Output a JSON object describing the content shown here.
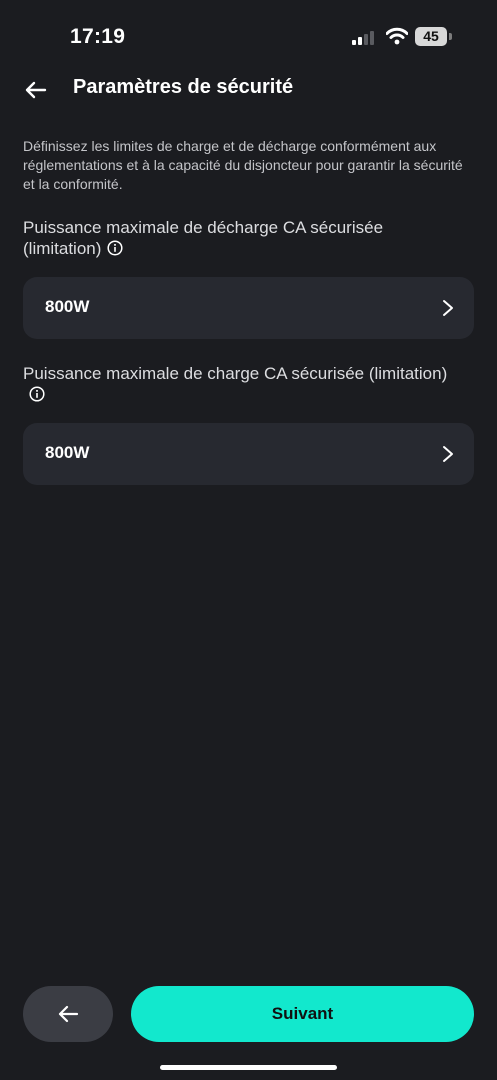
{
  "status_bar": {
    "time": "17:19",
    "battery": "45"
  },
  "header": {
    "title": "Paramètres de sécurité",
    "back_icon": "arrow-left-icon"
  },
  "description": "Définissez les limites de charge et de décharge conformément aux réglementations et à la capacité du disjoncteur pour garantir la sécurité et la conformité.",
  "settings": [
    {
      "label": "Puissance maximale de décharge CA sécurisée (limitation)",
      "value": "800W"
    },
    {
      "label": "Puissance maximale de charge CA sécurisée (limitation)",
      "value": "800W"
    }
  ],
  "footer": {
    "next_label": "Suivant",
    "accent_color": "#12e8cd"
  }
}
